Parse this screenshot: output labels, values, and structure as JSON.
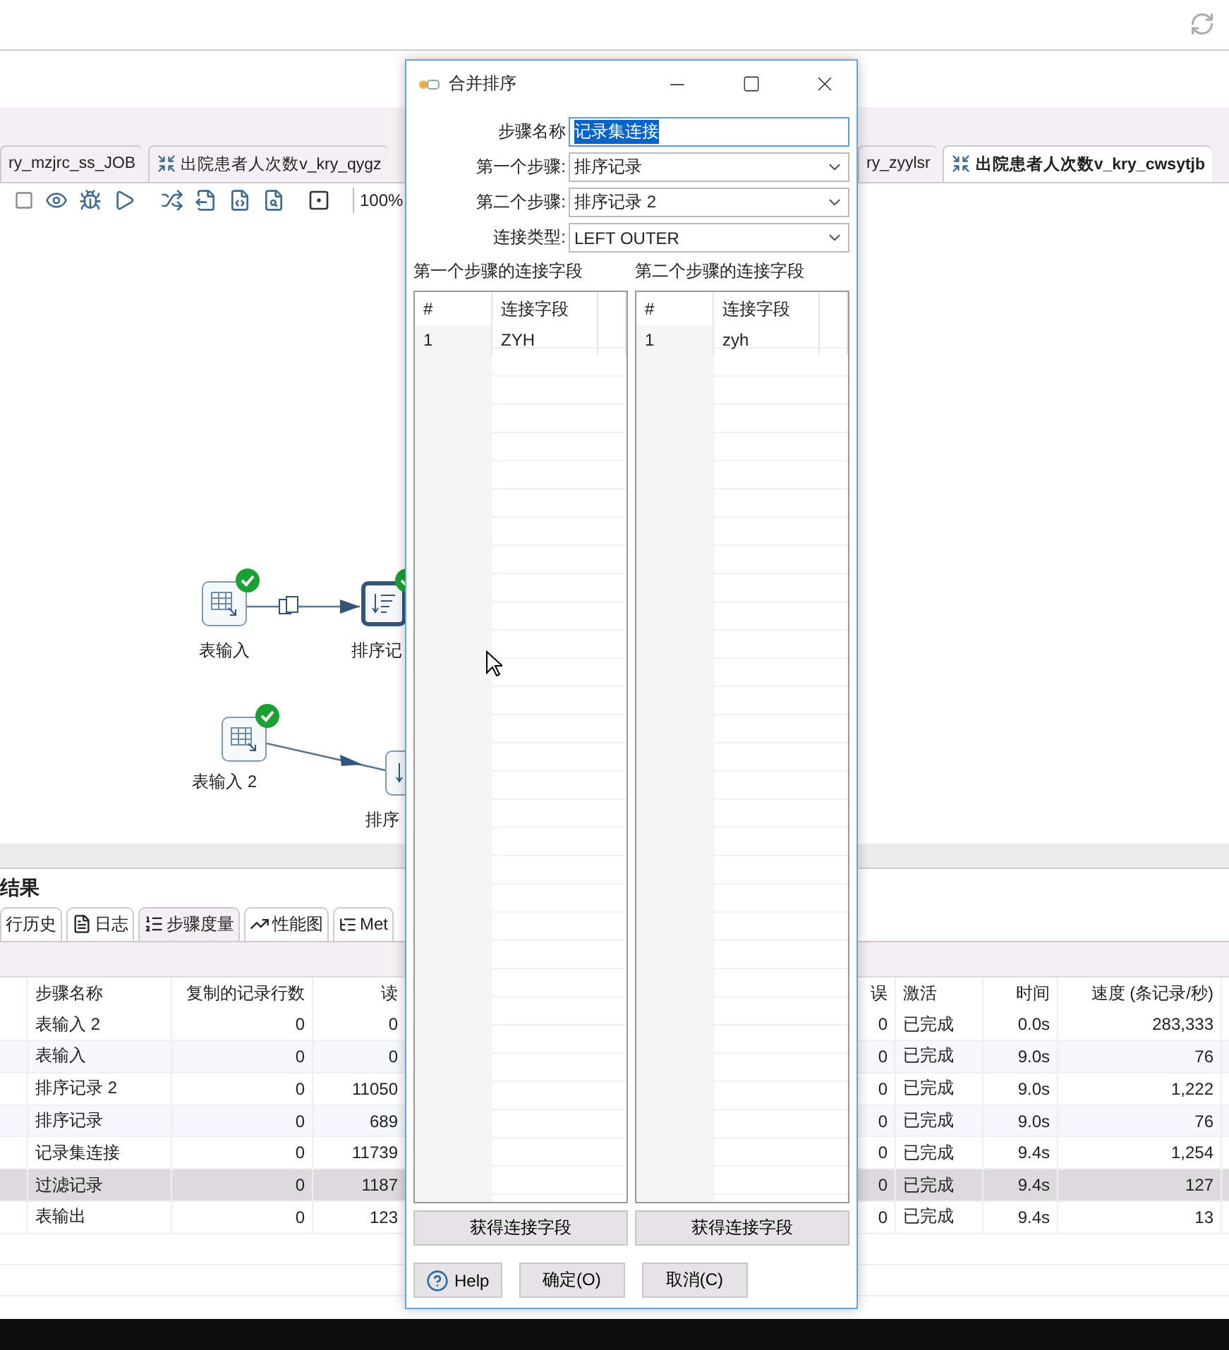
{
  "tabs": {
    "left": [
      {
        "label": "ry_mzjrc_ss_JOB",
        "kind": "job",
        "selected": false
      },
      {
        "label": "出院患者人次数v_kry_qygz",
        "kind": "transform",
        "selected": false
      }
    ],
    "right": [
      {
        "label": "ry_zyylsr",
        "kind": "job",
        "selected": false
      },
      {
        "label": "出院患者人次数v_kry_cwsytjb",
        "kind": "transform",
        "selected": true
      }
    ]
  },
  "toolbar": {
    "zoom": "100%"
  },
  "canvas": {
    "nodes": [
      {
        "label": "表输入",
        "kind": "table-input",
        "done": true
      },
      {
        "label": "排序记",
        "kind": "sort",
        "done": true
      },
      {
        "label": "表输入 2",
        "kind": "table-input",
        "done": true
      },
      {
        "label": "排序",
        "kind": "sort",
        "done": false
      }
    ]
  },
  "results": {
    "title": "结果",
    "tabs": [
      {
        "label": "行历史",
        "kind": "none",
        "selected": false
      },
      {
        "label": "日志",
        "kind": "log",
        "selected": false
      },
      {
        "label": "步骤度量",
        "kind": "metrics",
        "selected": true
      },
      {
        "label": "性能图",
        "kind": "chart",
        "selected": false
      },
      {
        "label": "Met",
        "kind": "meta",
        "selected": false
      }
    ],
    "columns_left": [
      "步骤名称",
      "复制的记录行数",
      "读"
    ],
    "columns_right": [
      "误",
      "激活",
      "时间",
      "速度 (条记录/秒)"
    ],
    "rows": [
      {
        "name": "表输入 2",
        "copied": "0",
        "read": "0",
        "errors": "0",
        "status": "已完成",
        "time": "0.0s",
        "speed": "283,333",
        "selected": false
      },
      {
        "name": "表输入",
        "copied": "0",
        "read": "0",
        "errors": "0",
        "status": "已完成",
        "time": "9.0s",
        "speed": "76",
        "selected": false
      },
      {
        "name": "排序记录 2",
        "copied": "0",
        "read": "11050",
        "errors": "0",
        "status": "已完成",
        "time": "9.0s",
        "speed": "1,222",
        "selected": false
      },
      {
        "name": "排序记录",
        "copied": "0",
        "read": "689",
        "errors": "0",
        "status": "已完成",
        "time": "9.0s",
        "speed": "76",
        "selected": false
      },
      {
        "name": "记录集连接",
        "copied": "0",
        "read": "11739",
        "errors": "0",
        "status": "已完成",
        "time": "9.4s",
        "speed": "1,254",
        "selected": false
      },
      {
        "name": "过滤记录",
        "copied": "0",
        "read": "1187",
        "errors": "0",
        "status": "已完成",
        "time": "9.4s",
        "speed": "127",
        "selected": true
      },
      {
        "name": "表输出",
        "copied": "0",
        "read": "123",
        "errors": "0",
        "status": "已完成",
        "time": "9.4s",
        "speed": "13",
        "selected": false
      }
    ]
  },
  "dialog": {
    "title": "合并排序",
    "fields": [
      {
        "label": "步骤名称",
        "value": "记录集连接",
        "kind": "text",
        "highlighted": true
      },
      {
        "label": "第一个步骤:",
        "value": "排序记录",
        "kind": "select",
        "highlighted": false
      },
      {
        "label": "第二个步骤:",
        "value": "排序记录 2",
        "kind": "select",
        "highlighted": false
      },
      {
        "label": "连接类型:",
        "value": "LEFT OUTER",
        "kind": "select",
        "highlighted": false
      }
    ],
    "key_tables": [
      {
        "title": "第一个步骤的连接字段",
        "columns": [
          "#",
          "连接字段"
        ],
        "rows": [
          [
            "1",
            "ZYH"
          ]
        ],
        "button": "获得连接字段"
      },
      {
        "title": "第二个步骤的连接字段",
        "columns": [
          "#",
          "连接字段"
        ],
        "rows": [
          [
            "1",
            "zyh"
          ]
        ],
        "button": "获得连接字段"
      }
    ],
    "buttons": [
      {
        "label": "Help",
        "kind": "help"
      },
      {
        "label": "确定(O)",
        "kind": "plain"
      },
      {
        "label": "取消(C)",
        "kind": "plain"
      }
    ]
  }
}
